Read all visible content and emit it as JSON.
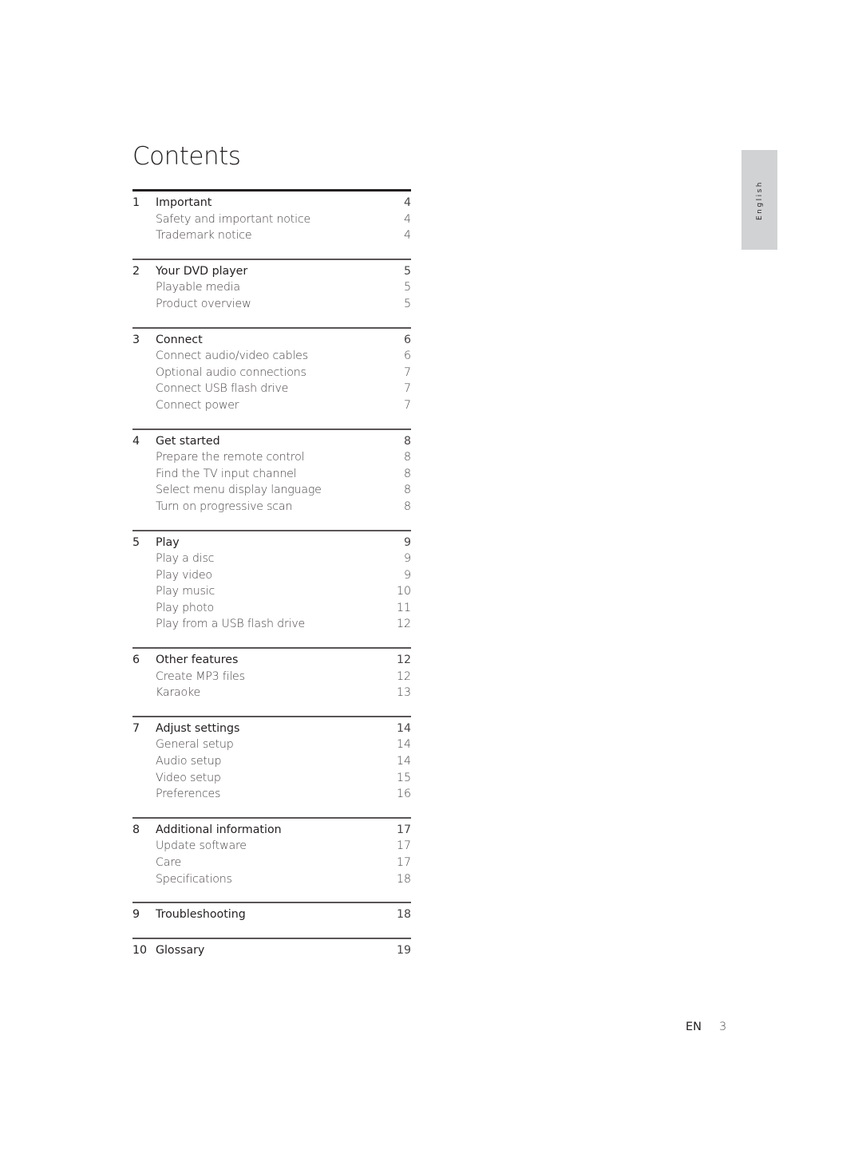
{
  "title": "Contents",
  "language_tab": "English",
  "footer": {
    "lang": "EN",
    "page": "3"
  },
  "sections": [
    {
      "num": "1",
      "label": "Important",
      "page": "4",
      "items": [
        {
          "label": "Safety and important notice",
          "page": "4"
        },
        {
          "label": "Trademark notice",
          "page": "4"
        }
      ]
    },
    {
      "num": "2",
      "label": "Your DVD player",
      "page": "5",
      "items": [
        {
          "label": "Playable media",
          "page": "5"
        },
        {
          "label": "Product overview",
          "page": "5"
        }
      ]
    },
    {
      "num": "3",
      "label": "Connect",
      "page": "6",
      "items": [
        {
          "label": "Connect audio/video cables",
          "page": "6"
        },
        {
          "label": "Optional audio connections",
          "page": "7"
        },
        {
          "label": "Connect USB flash drive",
          "page": "7"
        },
        {
          "label": "Connect power",
          "page": "7"
        }
      ]
    },
    {
      "num": "4",
      "label": "Get started",
      "page": "8",
      "items": [
        {
          "label": "Prepare the remote control",
          "page": "8"
        },
        {
          "label": "Find the TV input channel",
          "page": "8"
        },
        {
          "label": "Select menu display language",
          "page": "8"
        },
        {
          "label": "Turn on progressive scan",
          "page": "8"
        }
      ]
    },
    {
      "num": "5",
      "label": "Play",
      "page": "9",
      "items": [
        {
          "label": "Play a disc",
          "page": "9"
        },
        {
          "label": "Play video",
          "page": "9"
        },
        {
          "label": "Play music",
          "page": "10"
        },
        {
          "label": "Play photo",
          "page": "11"
        },
        {
          "label": "Play from a USB flash drive",
          "page": "12"
        }
      ]
    },
    {
      "num": "6",
      "label": "Other features",
      "page": "12",
      "items": [
        {
          "label": "Create MP3 files",
          "page": "12"
        },
        {
          "label": "Karaoke",
          "page": "13"
        }
      ]
    },
    {
      "num": "7",
      "label": "Adjust settings",
      "page": "14",
      "items": [
        {
          "label": "General setup",
          "page": "14"
        },
        {
          "label": "Audio setup",
          "page": "14"
        },
        {
          "label": "Video setup",
          "page": "15"
        },
        {
          "label": "Preferences",
          "page": "16"
        }
      ]
    },
    {
      "num": "8",
      "label": "Additional information",
      "page": "17",
      "items": [
        {
          "label": "Update software",
          "page": "17"
        },
        {
          "label": "Care",
          "page": "17"
        },
        {
          "label": "Specifications",
          "page": "18"
        }
      ]
    },
    {
      "num": "9",
      "label": "Troubleshooting",
      "page": "18",
      "items": []
    },
    {
      "num": "10",
      "label": "Glossary",
      "page": "19",
      "items": []
    }
  ]
}
